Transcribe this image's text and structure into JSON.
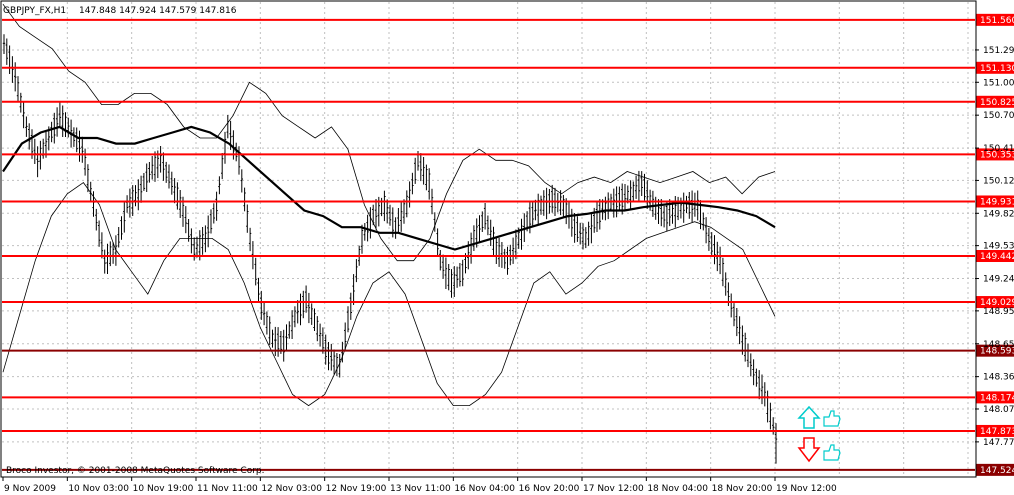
{
  "header": {
    "symbol_tf": "GBPJPY_FX,H1",
    "ohlc": "147.848 147.924 147.579 147.816"
  },
  "copyright": "Broco Investor, © 2001-2008 MetaQuotes Software Corp.",
  "colors": {
    "background": "#ffffff",
    "grid": "#c0c0c0",
    "level_line": "#ff0000",
    "level_line_dark": "#8b0000",
    "level_label_bg": "#ff0000",
    "level_label_bg_dark": "#8b0000",
    "price_bars": "#000000",
    "bands": "#000000",
    "arrow_up": "#00cccc",
    "arrow_down": "#ff0000"
  },
  "chart_data": {
    "type": "line",
    "title": "GBPJPY_FX,H1",
    "ylim": [
      147.46,
      151.72
    ],
    "y_ticks": [
      "151.290",
      "151.000",
      "150.705",
      "150.410",
      "150.120",
      "149.825",
      "149.535",
      "149.240",
      "148.950",
      "148.655",
      "148.360",
      "148.070",
      "147.775"
    ],
    "x_ticks": [
      "9 Nov 2009",
      "10 Nov 03:00",
      "10 Nov 19:00",
      "11 Nov 11:00",
      "12 Nov 03:00",
      "12 Nov 19:00",
      "13 Nov 11:00",
      "16 Nov 04:00",
      "16 Nov 20:00",
      "17 Nov 12:00",
      "18 Nov 04:00",
      "18 Nov 20:00",
      "19 Nov 12:00"
    ],
    "levels": [
      {
        "label": "151.560",
        "value": 151.56,
        "style": "red"
      },
      {
        "label": "151.130",
        "value": 151.13,
        "style": "red"
      },
      {
        "label": "150.825",
        "value": 150.825,
        "style": "red"
      },
      {
        "label": "150.353",
        "value": 150.353,
        "style": "red"
      },
      {
        "label": "149.931",
        "value": 149.931,
        "style": "red"
      },
      {
        "label": "149.442",
        "value": 149.442,
        "style": "red"
      },
      {
        "label": "149.029",
        "value": 149.029,
        "style": "red"
      },
      {
        "label": "148.593",
        "value": 148.593,
        "style": "dark"
      },
      {
        "label": "148.174",
        "value": 148.174,
        "style": "red"
      },
      {
        "label": "147.873",
        "value": 147.873,
        "style": "red"
      },
      {
        "label": "147.524",
        "value": 147.524,
        "style": "dark"
      }
    ],
    "series": [
      {
        "role": "close",
        "values": [
          151.35,
          151.05,
          150.6,
          150.3,
          150.5,
          150.7,
          150.55,
          150.4,
          149.9,
          149.4,
          149.5,
          149.9,
          150.0,
          150.2,
          150.3,
          150.1,
          149.85,
          149.5,
          149.6,
          149.9,
          150.6,
          150.3,
          149.6,
          149.0,
          148.7,
          148.65,
          148.9,
          149.05,
          148.8,
          148.55,
          148.45,
          149.0,
          149.6,
          149.8,
          149.9,
          149.7,
          149.9,
          150.3,
          150.1,
          149.4,
          149.2,
          149.3,
          149.6,
          149.8,
          149.5,
          149.4,
          149.6,
          149.8,
          149.9,
          149.95,
          149.9,
          149.7,
          149.6,
          149.8,
          149.9,
          149.95,
          150.0,
          150.1,
          149.9,
          149.8,
          149.85,
          149.9,
          149.9,
          149.6,
          149.4,
          149.0,
          148.7,
          148.4,
          148.2,
          147.82
        ]
      },
      {
        "role": "ma_thick",
        "values": [
          150.2,
          150.45,
          150.55,
          150.6,
          150.5,
          150.5,
          150.45,
          150.45,
          150.5,
          150.55,
          150.6,
          150.55,
          150.45,
          150.3,
          150.15,
          150.0,
          149.85,
          149.8,
          149.7,
          149.7,
          149.65,
          149.65,
          149.6,
          149.55,
          149.5,
          149.55,
          149.6,
          149.65,
          149.7,
          149.75,
          149.8,
          149.82,
          149.85,
          149.85,
          149.88,
          149.9,
          149.92,
          149.9,
          149.88,
          149.85,
          149.8,
          149.7
        ]
      },
      {
        "role": "band_upper",
        "values": [
          151.7,
          151.5,
          151.4,
          151.3,
          151.1,
          151.0,
          150.8,
          150.8,
          150.9,
          150.9,
          150.8,
          150.6,
          150.5,
          150.5,
          150.7,
          151.0,
          150.9,
          150.7,
          150.6,
          150.5,
          150.6,
          150.4,
          149.9,
          149.6,
          149.4,
          149.4,
          149.6,
          150.0,
          150.3,
          150.4,
          150.3,
          150.3,
          150.25,
          150.1,
          150.0,
          150.1,
          150.15,
          150.1,
          150.2,
          150.15,
          150.1,
          150.15,
          150.2,
          150.1,
          150.15,
          150.0,
          150.15,
          150.2
        ]
      },
      {
        "role": "band_lower",
        "values": [
          148.4,
          148.9,
          149.4,
          149.8,
          150.0,
          150.1,
          149.9,
          149.5,
          149.3,
          149.1,
          149.4,
          149.6,
          149.6,
          149.6,
          149.5,
          149.2,
          148.8,
          148.5,
          148.2,
          148.1,
          148.2,
          148.5,
          148.9,
          149.2,
          149.3,
          149.1,
          148.7,
          148.3,
          148.1,
          148.1,
          148.2,
          148.4,
          148.8,
          149.2,
          149.3,
          149.1,
          149.2,
          149.35,
          149.4,
          149.5,
          149.6,
          149.65,
          149.7,
          149.75,
          149.7,
          149.6,
          149.5,
          149.2,
          148.9
        ]
      }
    ]
  }
}
